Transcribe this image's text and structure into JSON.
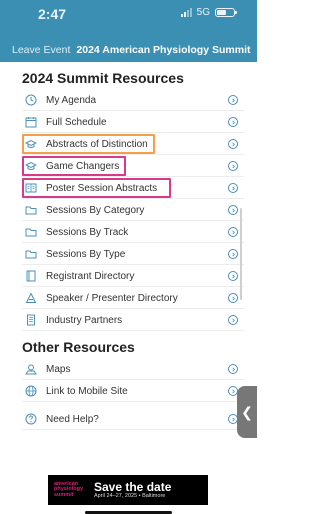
{
  "status": {
    "time": "2:47",
    "network": "5G"
  },
  "event_bar": {
    "leave": "Leave Event",
    "title": "2024 American Physiology Summit"
  },
  "summit_section": {
    "title": "2024 Summit Resources",
    "items": [
      {
        "label": "My Agenda",
        "icon": "clock-icon"
      },
      {
        "label": "Full Schedule",
        "icon": "calendar-icon"
      },
      {
        "label": "Abstracts of Distinction",
        "icon": "graduation-cap-icon"
      },
      {
        "label": "Game Changers",
        "icon": "graduation-cap-icon"
      },
      {
        "label": "Poster Session Abstracts",
        "icon": "poster-icon"
      },
      {
        "label": "Sessions By Category",
        "icon": "folder-icon"
      },
      {
        "label": "Sessions By Track",
        "icon": "folder-icon"
      },
      {
        "label": "Sessions By Type",
        "icon": "folder-icon"
      },
      {
        "label": "Registrant Directory",
        "icon": "book-icon"
      },
      {
        "label": "Speaker / Presenter Directory",
        "icon": "speaker-icon"
      },
      {
        "label": "Industry Partners",
        "icon": "document-icon"
      }
    ]
  },
  "other_section": {
    "title": "Other Resources",
    "items": [
      {
        "label": "Maps",
        "icon": "map-icon"
      },
      {
        "label": "Link to Mobile Site",
        "icon": "globe-icon"
      }
    ]
  },
  "help": {
    "label": "Need Help?",
    "icon": "question-icon"
  },
  "banner": {
    "brand_line1": "american",
    "brand_line2": "physiology",
    "brand_line3": "summit",
    "title": "Save the date",
    "subtitle": "April 24–27, 2025 • Baltimore"
  },
  "colors": {
    "header": "#3a8fb3",
    "accent": "#4a90b8",
    "highlight_orange": "#f0a24a",
    "highlight_pink": "#d63a8a"
  }
}
